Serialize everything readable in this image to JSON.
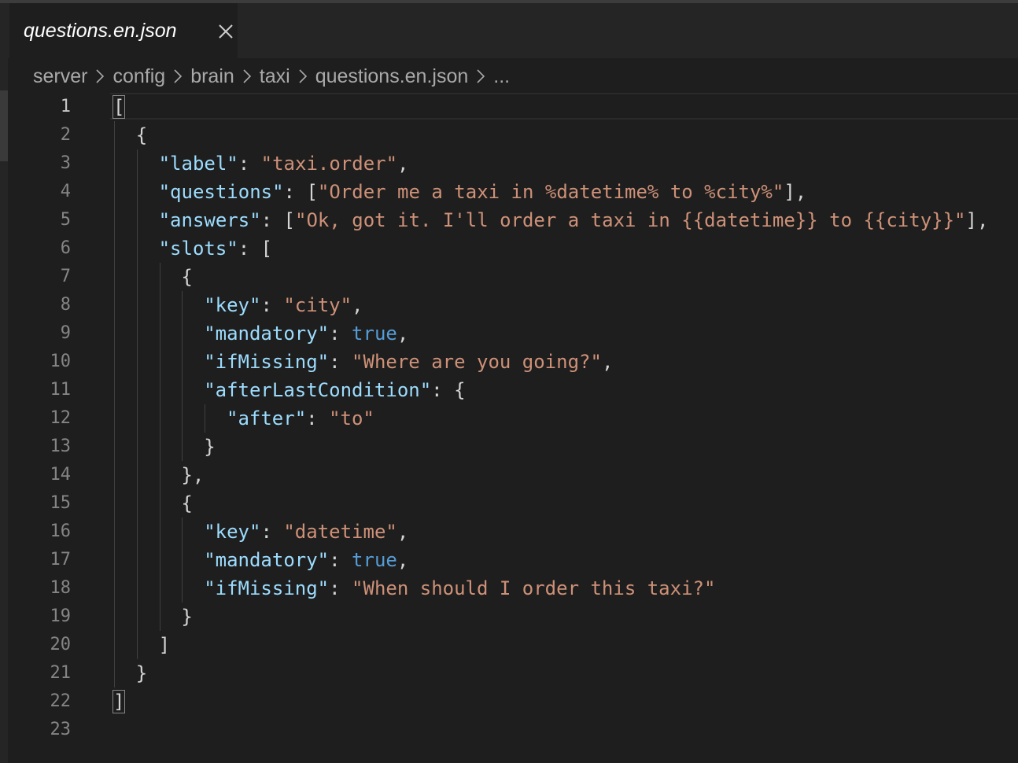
{
  "tab": {
    "title": "questions.en.json",
    "close_icon": "close-icon"
  },
  "breadcrumb": [
    "server",
    "config",
    "brain",
    "taxi",
    "questions.en.json",
    "..."
  ],
  "colors": {
    "background": "#1e1e1e",
    "key": "#9cdcfe",
    "string": "#ce9178",
    "keyword": "#569cd6",
    "punctuation": "#d4d4d4",
    "line_number": "#858585"
  },
  "editor": {
    "active_line": 1,
    "line_numbers": [
      "1",
      "2",
      "3",
      "4",
      "5",
      "6",
      "7",
      "8",
      "9",
      "10",
      "11",
      "12",
      "13",
      "14",
      "15",
      "16",
      "17",
      "18",
      "19",
      "20",
      "21",
      "22",
      "23"
    ],
    "lines": [
      [
        {
          "t": "[",
          "c": "punc",
          "match": true
        }
      ],
      [
        {
          "t": "{",
          "c": "punc"
        }
      ],
      [
        {
          "t": "\"label\"",
          "c": "key"
        },
        {
          "t": ": ",
          "c": "punc"
        },
        {
          "t": "\"taxi.order\"",
          "c": "str"
        },
        {
          "t": ",",
          "c": "punc"
        }
      ],
      [
        {
          "t": "\"questions\"",
          "c": "key"
        },
        {
          "t": ": [",
          "c": "punc"
        },
        {
          "t": "\"Order me a taxi in %datetime% to %city%\"",
          "c": "str"
        },
        {
          "t": "],",
          "c": "punc"
        }
      ],
      [
        {
          "t": "\"answers\"",
          "c": "key"
        },
        {
          "t": ": [",
          "c": "punc"
        },
        {
          "t": "\"Ok, got it. I'll order a taxi in {{datetime}} to {{city}}\"",
          "c": "str"
        },
        {
          "t": "],",
          "c": "punc"
        }
      ],
      [
        {
          "t": "\"slots\"",
          "c": "key"
        },
        {
          "t": ": [",
          "c": "punc"
        }
      ],
      [
        {
          "t": "{",
          "c": "punc"
        }
      ],
      [
        {
          "t": "\"key\"",
          "c": "key"
        },
        {
          "t": ": ",
          "c": "punc"
        },
        {
          "t": "\"city\"",
          "c": "str"
        },
        {
          "t": ",",
          "c": "punc"
        }
      ],
      [
        {
          "t": "\"mandatory\"",
          "c": "key"
        },
        {
          "t": ": ",
          "c": "punc"
        },
        {
          "t": "true",
          "c": "kw"
        },
        {
          "t": ",",
          "c": "punc"
        }
      ],
      [
        {
          "t": "\"ifMissing\"",
          "c": "key"
        },
        {
          "t": ": ",
          "c": "punc"
        },
        {
          "t": "\"Where are you going?\"",
          "c": "str"
        },
        {
          "t": ",",
          "c": "punc"
        }
      ],
      [
        {
          "t": "\"afterLastCondition\"",
          "c": "key"
        },
        {
          "t": ": {",
          "c": "punc"
        }
      ],
      [
        {
          "t": "\"after\"",
          "c": "key"
        },
        {
          "t": ": ",
          "c": "punc"
        },
        {
          "t": "\"to\"",
          "c": "str"
        }
      ],
      [
        {
          "t": "}",
          "c": "punc"
        }
      ],
      [
        {
          "t": "},",
          "c": "punc"
        }
      ],
      [
        {
          "t": "{",
          "c": "punc"
        }
      ],
      [
        {
          "t": "\"key\"",
          "c": "key"
        },
        {
          "t": ": ",
          "c": "punc"
        },
        {
          "t": "\"datetime\"",
          "c": "str"
        },
        {
          "t": ",",
          "c": "punc"
        }
      ],
      [
        {
          "t": "\"mandatory\"",
          "c": "key"
        },
        {
          "t": ": ",
          "c": "punc"
        },
        {
          "t": "true",
          "c": "kw"
        },
        {
          "t": ",",
          "c": "punc"
        }
      ],
      [
        {
          "t": "\"ifMissing\"",
          "c": "key"
        },
        {
          "t": ": ",
          "c": "punc"
        },
        {
          "t": "\"When should I order this taxi?\"",
          "c": "str"
        }
      ],
      [
        {
          "t": "}",
          "c": "punc"
        }
      ],
      [
        {
          "t": "]",
          "c": "punc"
        }
      ],
      [
        {
          "t": "}",
          "c": "punc"
        }
      ],
      [
        {
          "t": "]",
          "c": "punc",
          "match": true
        }
      ],
      []
    ]
  }
}
